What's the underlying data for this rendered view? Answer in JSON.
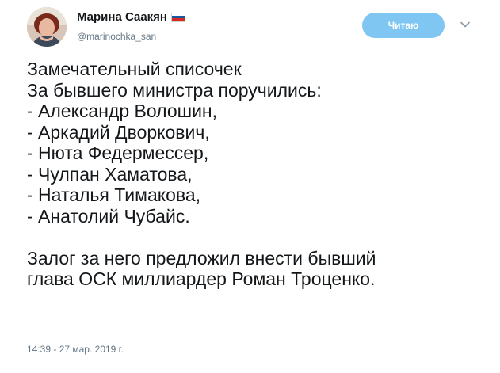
{
  "author": {
    "name": "Марина Саакян",
    "handle": "@marinochka_san",
    "flag_icon": "russia-flag-icon"
  },
  "follow_button": {
    "label": "Читаю",
    "color": "#7fc6f2"
  },
  "menu": {
    "icon": "chevron-down-icon"
  },
  "tweet": {
    "lines": [
      "Замечательный списочек",
      "За бывшего министра поручились:",
      "- Александр Волошин,",
      "- Аркадий Дворкович,",
      "- Нюта Федермессер,",
      "- Чулпан Хаматова,",
      "- Наталья Тимакова,",
      "- Анатолий Чубайс."
    ],
    "paragraph2": [
      "Залог за него предложил внести бывший",
      "глава ОСК миллиардер Роман Троценко."
    ],
    "timestamp": "14:39 - 27 мар. 2019 г."
  }
}
